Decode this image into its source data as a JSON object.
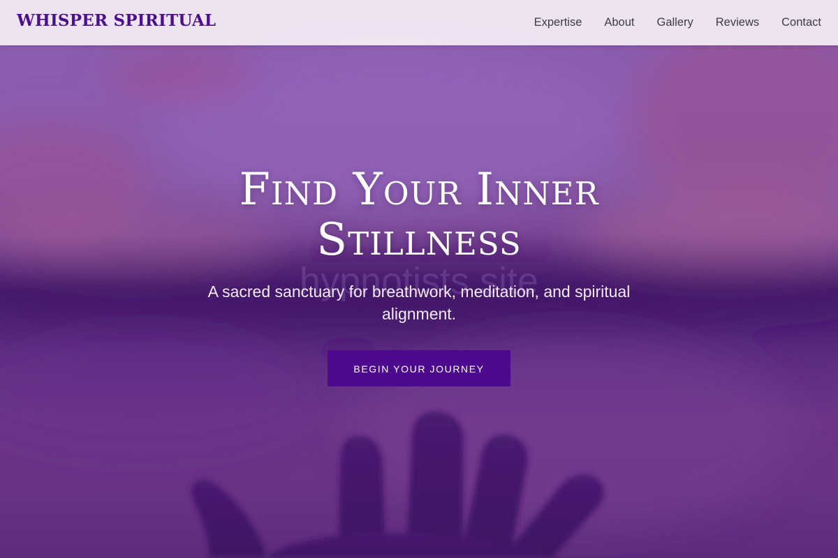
{
  "header": {
    "logo": "WHISPER SPIRITUAL",
    "nav": [
      {
        "label": "Expertise"
      },
      {
        "label": "About"
      },
      {
        "label": "Gallery"
      },
      {
        "label": "Reviews"
      },
      {
        "label": "Contact"
      }
    ]
  },
  "hero": {
    "title": "Find Your Inner Stillness",
    "watermark": "hypnotists site",
    "subtitle": "A sacred sanctuary for breathwork, meditation, and spiritual alignment.",
    "cta_label": "Begin Your Journey"
  },
  "colors": {
    "brand": "#4a0f8a",
    "button": "#4e0a8e",
    "header_bg": "#f5eef6",
    "hero_purple": "#8a5cae"
  },
  "icons": [
    "hand-silhouette-image"
  ]
}
